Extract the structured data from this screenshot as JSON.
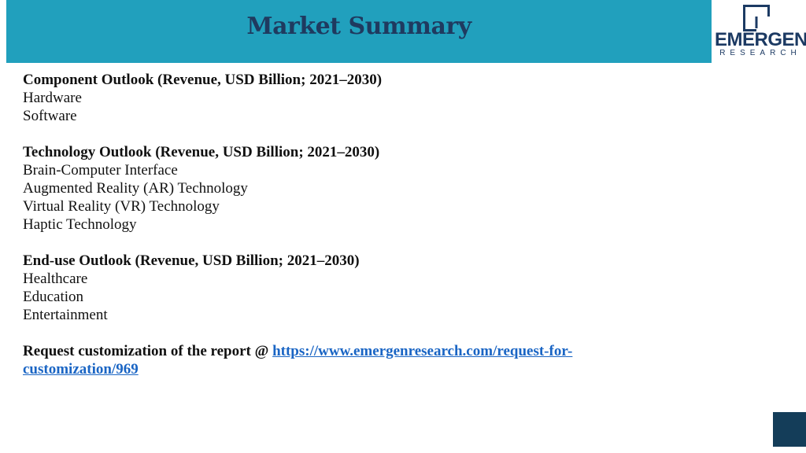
{
  "header": {
    "title": "Market Summary"
  },
  "logo": {
    "word": "EMERGEN",
    "sub": "RESEARCH"
  },
  "sections": [
    {
      "heading": "Component Outlook (Revenue, USD Billion; 2021–2030)",
      "items": [
        "Hardware",
        "Software"
      ]
    },
    {
      "heading": "Technology Outlook (Revenue, USD Billion; 2021–2030)",
      "items": [
        "Brain-Computer Interface",
        "Augmented Reality (AR) Technology",
        "Virtual Reality (VR) Technology",
        "Haptic Technology"
      ]
    },
    {
      "heading": "End-use Outlook (Revenue, USD Billion; 2021–2030)",
      "items": [
        "Healthcare",
        "Education",
        "Entertainment"
      ]
    }
  ],
  "request": {
    "label": "Request customization of the report @ ",
    "link_text": "https://www.emergenresearch.com/request-for-customization/969",
    "link_href": "https://www.emergenresearch.com/request-for-customization/969"
  },
  "colors": {
    "header_band": "#21a0bd",
    "title": "#1f3a5f",
    "link": "#1a65c4",
    "corner": "#143d59"
  }
}
